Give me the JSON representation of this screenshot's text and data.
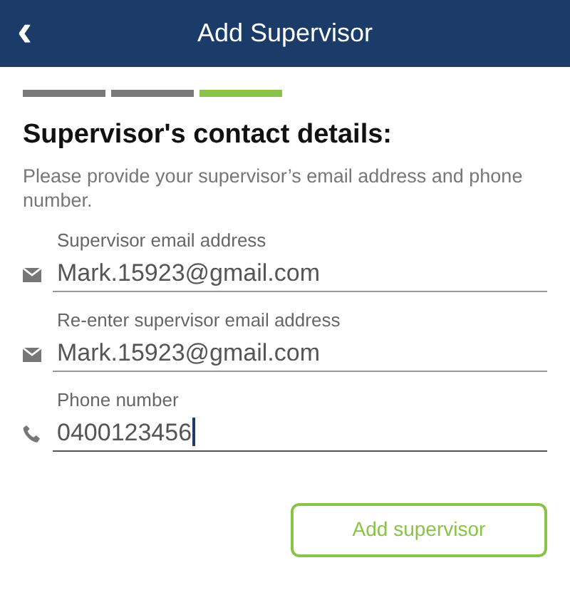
{
  "header": {
    "back_icon": "‹",
    "title": "Add Supervisor"
  },
  "steps": [
    {
      "selected": false
    },
    {
      "selected": false
    },
    {
      "selected": true
    }
  ],
  "heading": "Supervisor's contact details:",
  "description": "Please provide your supervisor’s email address and phone number.",
  "fields": [
    {
      "kind": "email",
      "label": "Supervisor email address",
      "value": "Mark.15923@gmail.com",
      "focused": false
    },
    {
      "kind": "email",
      "label": "Re-enter supervisor email address",
      "value": "Mark.15923@gmail.com",
      "focused": false
    },
    {
      "kind": "phone",
      "label": "Phone number",
      "value": "0400123456",
      "focused": true
    }
  ],
  "button": "Add supervisor"
}
